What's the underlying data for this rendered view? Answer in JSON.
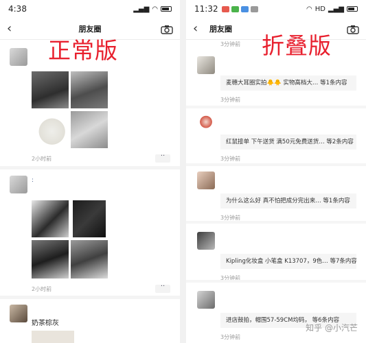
{
  "left": {
    "status_time": "4:38",
    "nav_title": "朋友圈",
    "overlay_label": "正常版",
    "posts": [
      {
        "time": "2小时前"
      },
      {
        "name": ":",
        "time": "2小时前"
      },
      {
        "name": "奶茶棕灰"
      }
    ]
  },
  "right": {
    "status_time": "11:32",
    "status_right": "HD",
    "nav_title": "朋友圈",
    "overlay_label": "折叠版",
    "top_time": "3分钟前",
    "folded_posts": [
      {
        "summary": "麦穗大耳圈实拍🐥🐥 实物高档大…  等1条内容",
        "time": "3分钟前"
      },
      {
        "summary": "红鼠接单 下午送货 满50元免费送货… 等2条内容",
        "time": "3分钟前"
      },
      {
        "summary": "为什么这么好 真不怕把成分完出来… 等1条内容",
        "time": "3分钟前"
      },
      {
        "summary": "Kipling化妆盒 小笔盒 K13707，9色… 等7条内容",
        "time": "3分钟前"
      },
      {
        "summary": "进店鼓拍，帽围57-59CM均码，  等6条内容",
        "time": "3分钟前"
      }
    ]
  },
  "watermark": "知乎 @小汽芒",
  "colors": {
    "overlay_red": "#e8202e",
    "time_gray": "#9a9a9a",
    "separator": "#f4f4f4"
  }
}
